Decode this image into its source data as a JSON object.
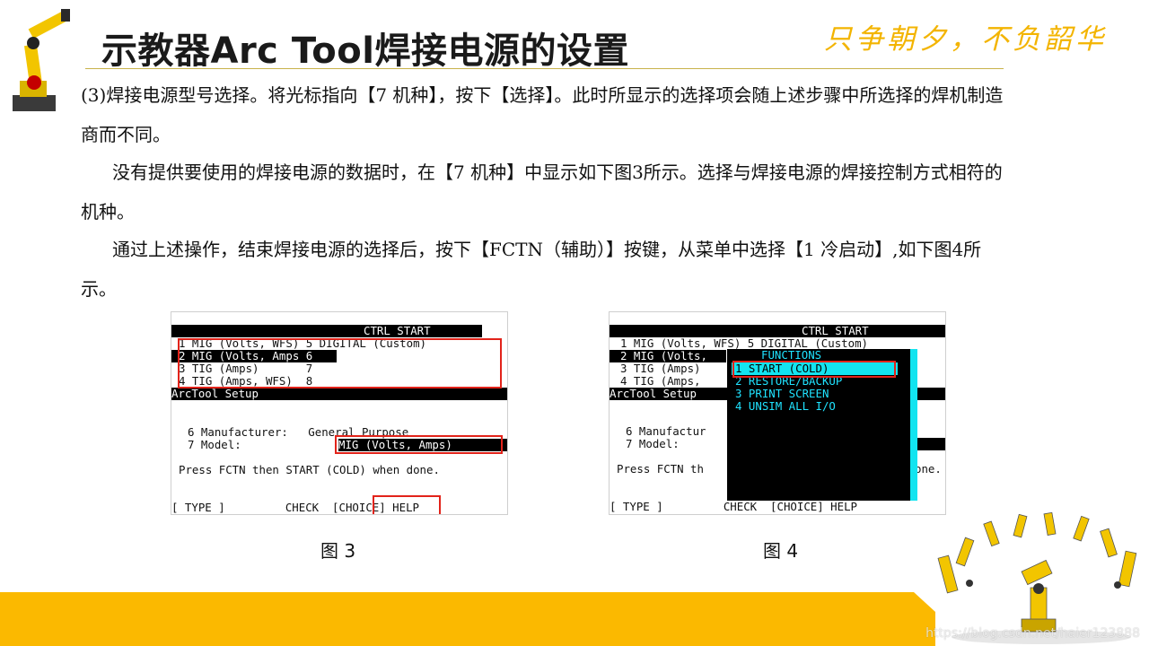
{
  "header": {
    "title": "示教器Arc Tool焊接电源的设置",
    "slogan": "只争朝夕，不负韶华"
  },
  "body": {
    "p1": "(3)焊接电源型号选择。将光标指向【7 机种】，按下【选择】。此时所显示的选择项会随上述步骤中所选择的焊机制造商而不同。",
    "p2": "没有提供要使用的焊接电源的数据时，在【7 机种】中显示如下图3所示。选择与焊接电源的焊接控制方式相符的机种。",
    "p3": "通过上述操作，结束焊接电源的选择后，按下【FCTN（辅助）】按键，从菜单中选择【1 冷启动】,如下图4所示。"
  },
  "fig3": {
    "header": "CTRL START",
    "rows": [
      "1 MIG (Volts, WFS) 5 DIGITAL (Custom)",
      "2 MIG (Volts, Amps 6",
      "3 TIG (Amps)       7",
      "4 TIG (Amps, WFS)  8"
    ],
    "setup_bar": "ArcTool Setup",
    "manufacturer": "6 Manufacturer:   General Purpose",
    "model_label": "7 Model:",
    "model_value": "MIG (Volts, Amps)",
    "press": "Press FCTN then START (COLD) when done.",
    "softkeys": "[ TYPE ]         CHECK  [CHOICE] HELP",
    "caption": "图 3"
  },
  "fig4": {
    "header": "CTRL START",
    "rows": [
      "1 MIG (Volts, WFS) 5 DIGITAL (Custom)",
      "2 MIG (Volts,",
      "3 TIG (Amps)",
      "4 TIG (Amps,"
    ],
    "setup_bar": "ArcTool Setup",
    "manufacturer": "6 Manufactur",
    "model_label": "7 Model:",
    "model_tail": ")",
    "press": "Press FCTN th",
    "press_tail": "one.",
    "softkeys": "[ TYPE ]         CHECK  [CHOICE] HELP",
    "menu": {
      "title": "FUNCTIONS",
      "items": [
        "1 START (COLD)",
        "2 RESTORE/BACKUP",
        "3 PRINT SCREEN",
        "4 UNSIM ALL I/O"
      ]
    },
    "caption": "图 4"
  },
  "watermark": "https://blog.csdn.net/haier123888",
  "colors": {
    "accent": "#fbb900",
    "highlight_box": "#e2231a",
    "menu_cyan": "#12e4f0"
  }
}
